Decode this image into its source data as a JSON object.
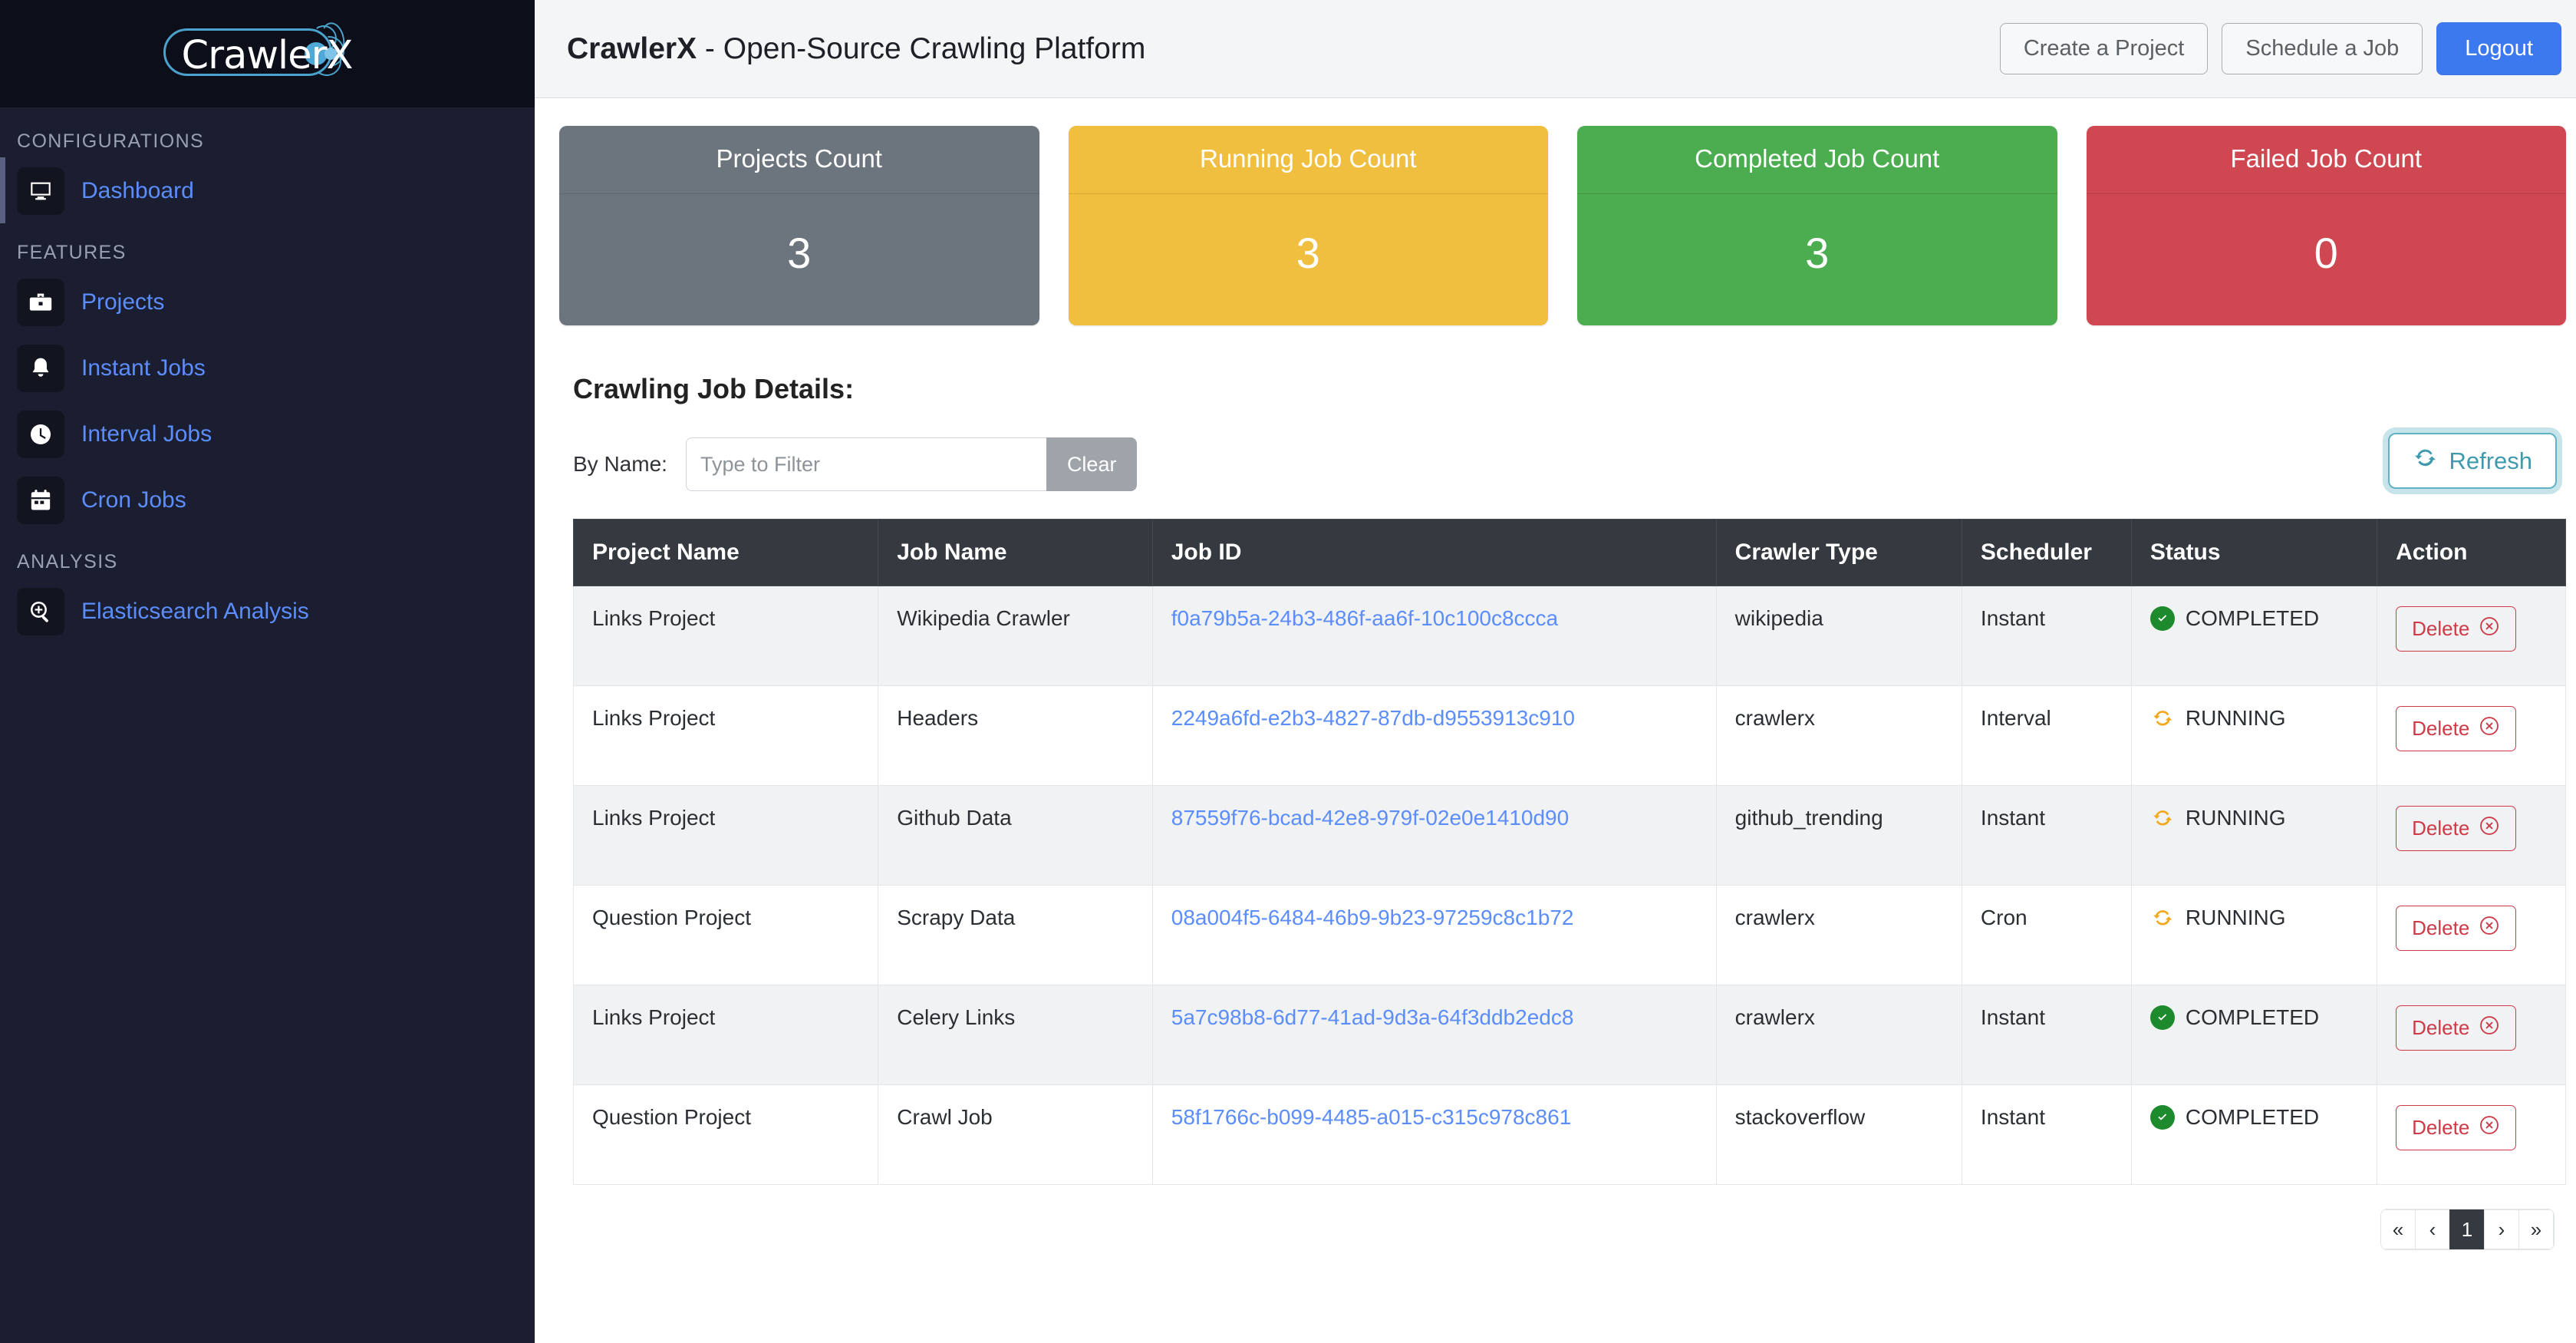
{
  "sidebar": {
    "logo_text": "CrawlerX",
    "sections": [
      {
        "title": "CONFIGURATIONS"
      },
      {
        "title": "FEATURES"
      },
      {
        "title": "ANALYSIS"
      }
    ],
    "items": [
      {
        "label": "Dashboard",
        "icon": "monitor-icon",
        "active": true
      },
      {
        "label": "Projects",
        "icon": "briefcase-icon",
        "active": false
      },
      {
        "label": "Instant Jobs",
        "icon": "bell-icon",
        "active": false
      },
      {
        "label": "Interval Jobs",
        "icon": "clock-icon",
        "active": false
      },
      {
        "label": "Cron Jobs",
        "icon": "calendar-icon",
        "active": false
      },
      {
        "label": "Elasticsearch Analysis",
        "icon": "search-plus-icon",
        "active": false
      }
    ]
  },
  "topbar": {
    "title_bold": "CrawlerX",
    "title_rest": " - Open-Source Crawling Platform",
    "create_project_label": "Create a Project",
    "schedule_job_label": "Schedule a Job",
    "logout_label": "Logout"
  },
  "cards": [
    {
      "title": "Projects Count",
      "value": "3",
      "color": "#6c757d"
    },
    {
      "title": "Running Job Count",
      "value": "3",
      "color": "#f0bf40"
    },
    {
      "title": "Completed Job Count",
      "value": "3",
      "color": "#4cad50"
    },
    {
      "title": "Failed Job Count",
      "value": "0",
      "color": "#cf4751"
    }
  ],
  "section": {
    "title": "Crawling Job Details:",
    "filter_label": "By Name:",
    "filter_value": "",
    "filter_placeholder": "Type to Filter",
    "clear_label": "Clear",
    "refresh_label": "Refresh"
  },
  "table": {
    "columns": [
      "Project Name",
      "Job Name",
      "Job ID",
      "Crawler Type",
      "Scheduler",
      "Status",
      "Action"
    ],
    "delete_label": "Delete",
    "rows": [
      {
        "project": "Links Project",
        "job_name": "Wikipedia Crawler",
        "job_id": "f0a79b5a-24b3-486f-aa6f-10c100c8ccca",
        "crawler_type": "wikipedia",
        "scheduler": "Instant",
        "status": "COMPLETED"
      },
      {
        "project": "Links Project",
        "job_name": "Headers",
        "job_id": "2249a6fd-e2b3-4827-87db-d9553913c910",
        "crawler_type": "crawlerx",
        "scheduler": "Interval",
        "status": "RUNNING"
      },
      {
        "project": "Links Project",
        "job_name": "Github Data",
        "job_id": "87559f76-bcad-42e8-979f-02e0e1410d90",
        "crawler_type": "github_trending",
        "scheduler": "Instant",
        "status": "RUNNING"
      },
      {
        "project": "Question Project",
        "job_name": "Scrapy Data",
        "job_id": "08a004f5-6484-46b9-9b23-97259c8c1b72",
        "crawler_type": "crawlerx",
        "scheduler": "Cron",
        "status": "RUNNING"
      },
      {
        "project": "Links Project",
        "job_name": "Celery Links",
        "job_id": "5a7c98b8-6d77-41ad-9d3a-64f3ddb2edc8",
        "crawler_type": "crawlerx",
        "scheduler": "Instant",
        "status": "COMPLETED"
      },
      {
        "project": "Question Project",
        "job_name": "Crawl Job",
        "job_id": "58f1766c-b099-4485-a015-c315c978c861",
        "crawler_type": "stackoverflow",
        "scheduler": "Instant",
        "status": "COMPLETED"
      }
    ]
  },
  "pagination": {
    "first_label": "«",
    "prev_label": "‹",
    "pages": [
      "1"
    ],
    "current_page": "1",
    "next_label": "›",
    "last_label": "»"
  },
  "colors": {
    "accent_blue": "#3c79ef",
    "link_blue": "#5b8dfc",
    "status_completed": "#1e8a2e",
    "status_running": "#f0a81f",
    "delete_red": "#cc3b47",
    "refresh_teal": "#5fb3c4"
  }
}
